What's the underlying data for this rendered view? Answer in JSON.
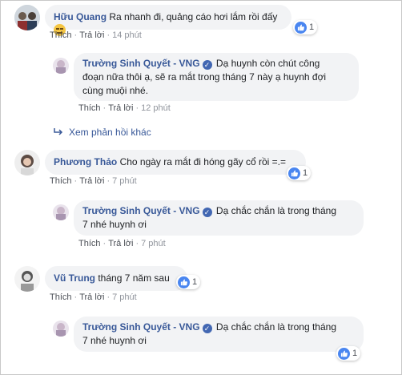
{
  "comments": [
    {
      "author": "Hữu Quang",
      "text": "Ra nhanh đi, quảng cáo hơi lắm rồi đấy",
      "emoji": "neutral-face-emoji",
      "like": "Thích",
      "reply": "Trả lời",
      "time": "14 phút",
      "reactions": "1",
      "replies": [
        {
          "author": "Trường Sinh Quyết - VNG",
          "verified": true,
          "text_lines": [
            "Dạ huynh còn chút công",
            "đoạn nữa thôi ạ, sẽ ra mắt trong tháng 7 này ạ huynh đợi",
            "cùng muội nhé."
          ],
          "like": "Thích",
          "reply": "Trả lời",
          "time": "12 phút"
        }
      ],
      "more_replies": "Xem phản hồi khác"
    },
    {
      "author": "Phương Thảo",
      "text": "Cho ngày ra mắt đi hóng gãy cổ rồi =.=",
      "like": "Thích",
      "reply": "Trả lời",
      "time": "7 phút",
      "reactions": "1",
      "replies": [
        {
          "author": "Trường Sinh Quyết - VNG",
          "verified": true,
          "text_lines": [
            "Dạ chắc chắn là trong tháng",
            "7 nhé huynh ơi"
          ],
          "like": "Thích",
          "reply": "Trả lời",
          "time": "7 phút"
        }
      ]
    },
    {
      "author": "Vũ Trung",
      "text": "tháng 7 năm sau",
      "like": "Thích",
      "reply": "Trả lời",
      "time": "7 phút",
      "reactions": "1",
      "replies": [
        {
          "author": "Trường Sinh Quyết - VNG",
          "verified": true,
          "text_lines": [
            "Dạ chắc chắn là trong tháng",
            "7 nhé huynh ơi"
          ],
          "reactions": "1"
        }
      ]
    }
  ],
  "colors": {
    "link": "#385898",
    "bubble": "#f2f3f5",
    "like": "#4a86f0",
    "meta": "#90949c"
  }
}
